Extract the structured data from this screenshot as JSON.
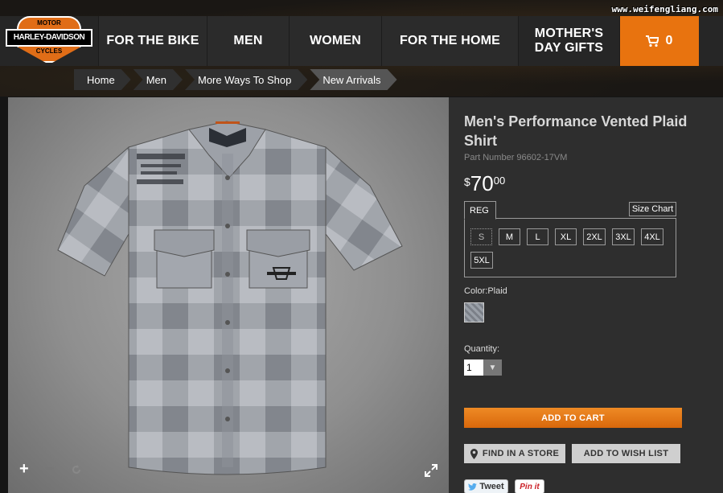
{
  "watermark": "www.weifengliang.com",
  "logo": {
    "top_text": "MOTOR",
    "mid_text": "HARLEY-DAVIDSON",
    "bot_text": "CYCLES"
  },
  "nav": {
    "items": [
      {
        "label": "FOR THE BIKE"
      },
      {
        "label": "MEN"
      },
      {
        "label": "WOMEN"
      },
      {
        "label": "FOR THE HOME"
      },
      {
        "label": "MOTHER'S DAY GIFTS"
      }
    ],
    "cart_icon": "cart-icon",
    "cart_count": "0"
  },
  "breadcrumb": [
    {
      "label": "Home"
    },
    {
      "label": "Men"
    },
    {
      "label": "More Ways To Shop"
    },
    {
      "label": "New Arrivals"
    }
  ],
  "photo": {
    "zoom_in": "+",
    "zoom_out": "−",
    "reset_icon": "rotate-icon",
    "fullscreen_icon": "expand-icon"
  },
  "product": {
    "title": "Men's Performance Vented Plaid Shirt",
    "part_number": "Part Number  96602-17VM",
    "price": {
      "currency": "$",
      "whole": "70",
      "cents": "00"
    },
    "fit_tab": "REG",
    "size_chart": "Size Chart",
    "sizes": [
      "S",
      "M",
      "L",
      "XL",
      "2XL",
      "3XL",
      "4XL",
      "5XL"
    ],
    "selected_size": "S",
    "color_label": "Color:Plaid",
    "quantity_label": "Quantity:",
    "quantity": "1",
    "add_to_cart": "ADD TO CART",
    "find_in_store": "FIND IN A STORE",
    "add_to_wishlist": "ADD TO WISH LIST",
    "tweet": "Tweet",
    "pin": "Pin it"
  },
  "colors": {
    "accent": "#e8730f",
    "nav_bg": "#2b2b2b",
    "panel_bg": "#2e2e2e"
  }
}
